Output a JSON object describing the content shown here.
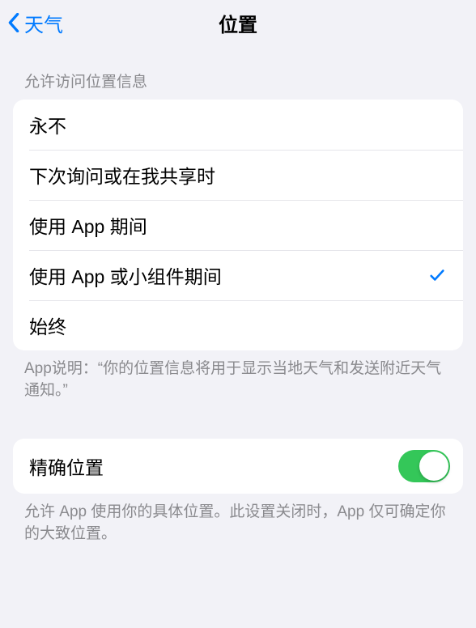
{
  "nav": {
    "back_label": "天气",
    "title": "位置"
  },
  "section1": {
    "header": "允许访问位置信息",
    "options": [
      {
        "label": "永不",
        "selected": false
      },
      {
        "label": "下次询问或在我共享时",
        "selected": false
      },
      {
        "label": "使用 App 期间",
        "selected": false
      },
      {
        "label": "使用 App 或小组件期间",
        "selected": true
      },
      {
        "label": "始终",
        "selected": false
      }
    ],
    "footer": "App说明：“你的位置信息将用于显示当地天气和发送附近天气通知。”"
  },
  "section2": {
    "precise_label": "精确位置",
    "precise_on": true,
    "footer": "允许 App 使用你的具体位置。此设置关闭时，App 仅可确定你的大致位置。"
  }
}
